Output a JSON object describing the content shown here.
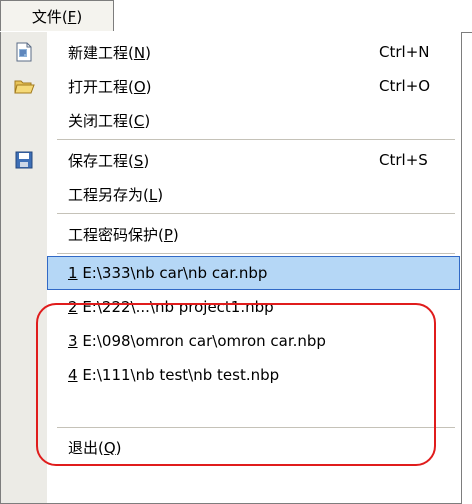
{
  "menubar": {
    "file_menu_label": "文件(F)"
  },
  "menu": {
    "items": [
      {
        "label": "新建工程(N)",
        "shortcut": "Ctrl+N",
        "icon": "new-project-icon"
      },
      {
        "label": "打开工程(O)",
        "shortcut": "Ctrl+O",
        "icon": "open-folder-icon"
      },
      {
        "label": "关闭工程(C)",
        "shortcut": ""
      },
      {
        "label": "保存工程(S)",
        "shortcut": "Ctrl+S",
        "icon": "floppy-disk-icon"
      },
      {
        "label": "工程另存为(L)",
        "shortcut": ""
      },
      {
        "label": "工程密码保护(P)",
        "shortcut": ""
      }
    ],
    "recent_files": [
      {
        "number": "1",
        "path": " E:\\333\\nb car\\nb car.nbp",
        "selected": true
      },
      {
        "number": "2",
        "path": " E:\\222\\...\\nb project1.nbp",
        "selected": false
      },
      {
        "number": "3",
        "path": " E:\\098\\omron car\\omron car.nbp",
        "selected": false
      },
      {
        "number": "4",
        "path": " E:\\111\\nb test\\nb test.nbp",
        "selected": false
      }
    ],
    "exit": {
      "label": "退出(Q)"
    }
  },
  "colors": {
    "highlight": "#3d95e8",
    "callout": "#e01c1c",
    "gutter": "#ecebe6"
  }
}
